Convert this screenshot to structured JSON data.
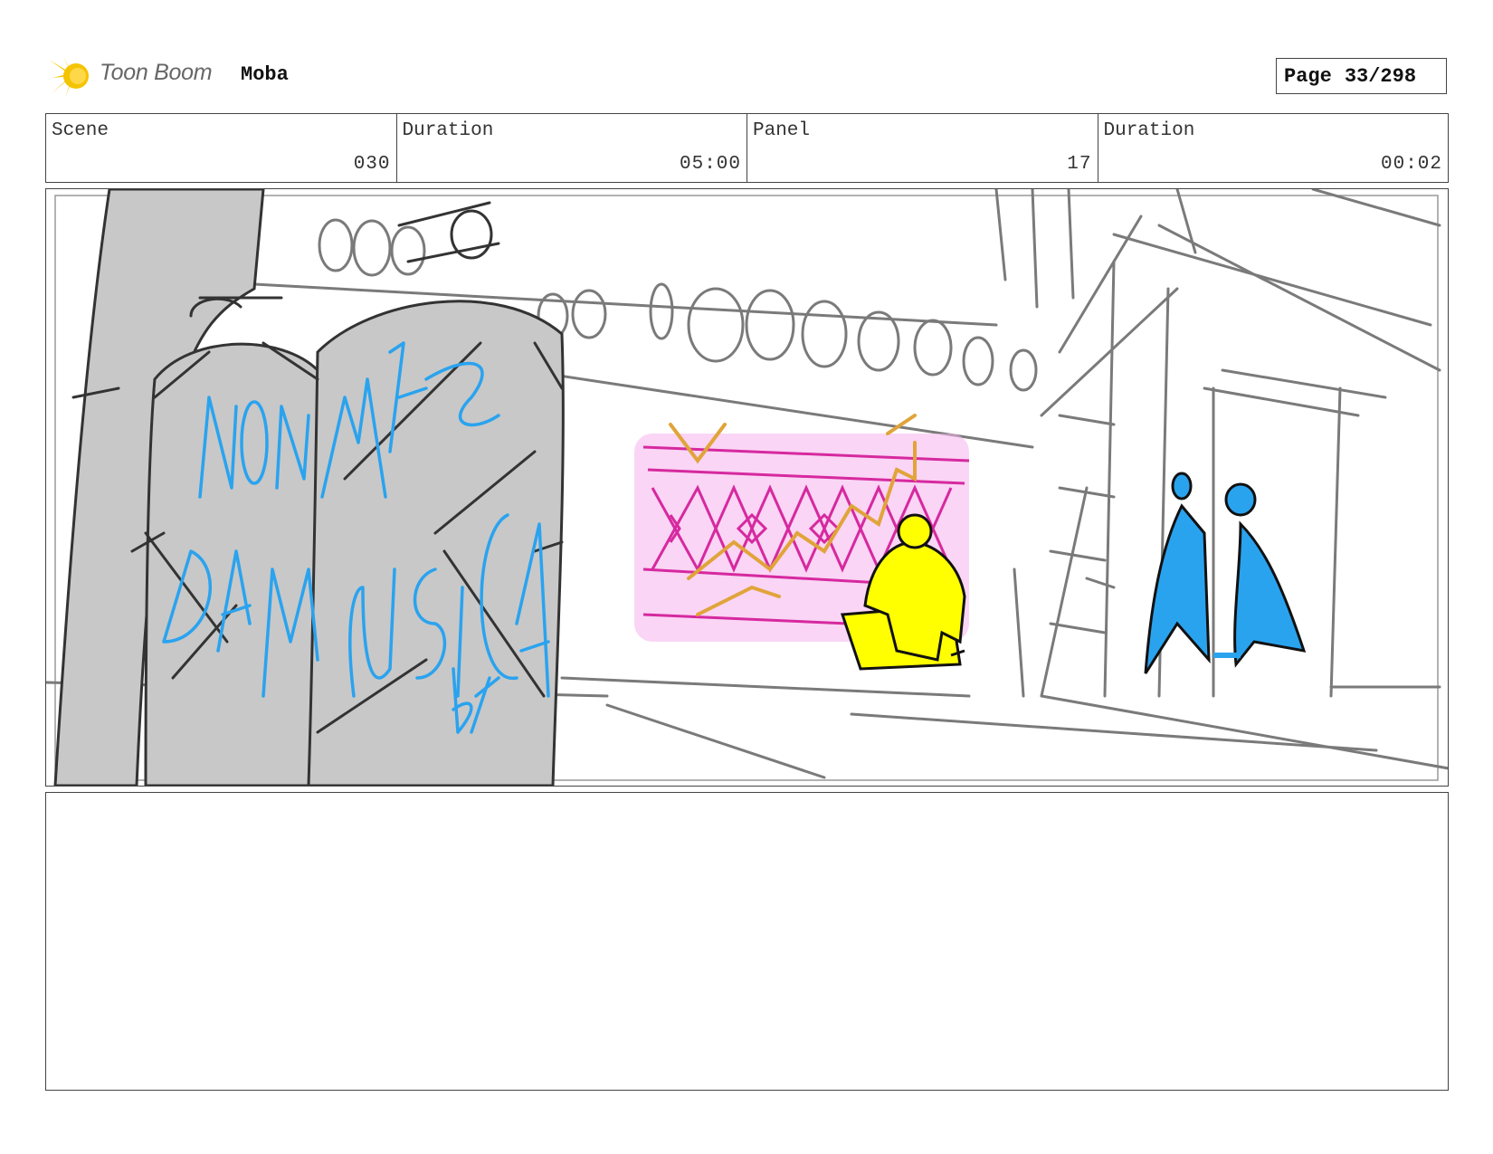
{
  "header": {
    "logo_text": "Toon Boom",
    "project": "Moba",
    "page_label": "Page",
    "page_value": "33/298"
  },
  "meta": [
    {
      "label": "Scene",
      "value": "030"
    },
    {
      "label": "Duration",
      "value": "05:00"
    },
    {
      "label": "Panel",
      "value": "17"
    },
    {
      "label": "Duration",
      "value": "00:02"
    }
  ],
  "panel": {
    "colors": {
      "tank_fill": "#c8c8c8",
      "graffiti": "#2aa3ef",
      "mural": "#e23fc4",
      "mural_gold": "#e0a43a",
      "character": "#ffff00",
      "figures": "#2aa3ef",
      "sketch": "#7a7a7a"
    }
  },
  "notes": {
    "text": ""
  }
}
